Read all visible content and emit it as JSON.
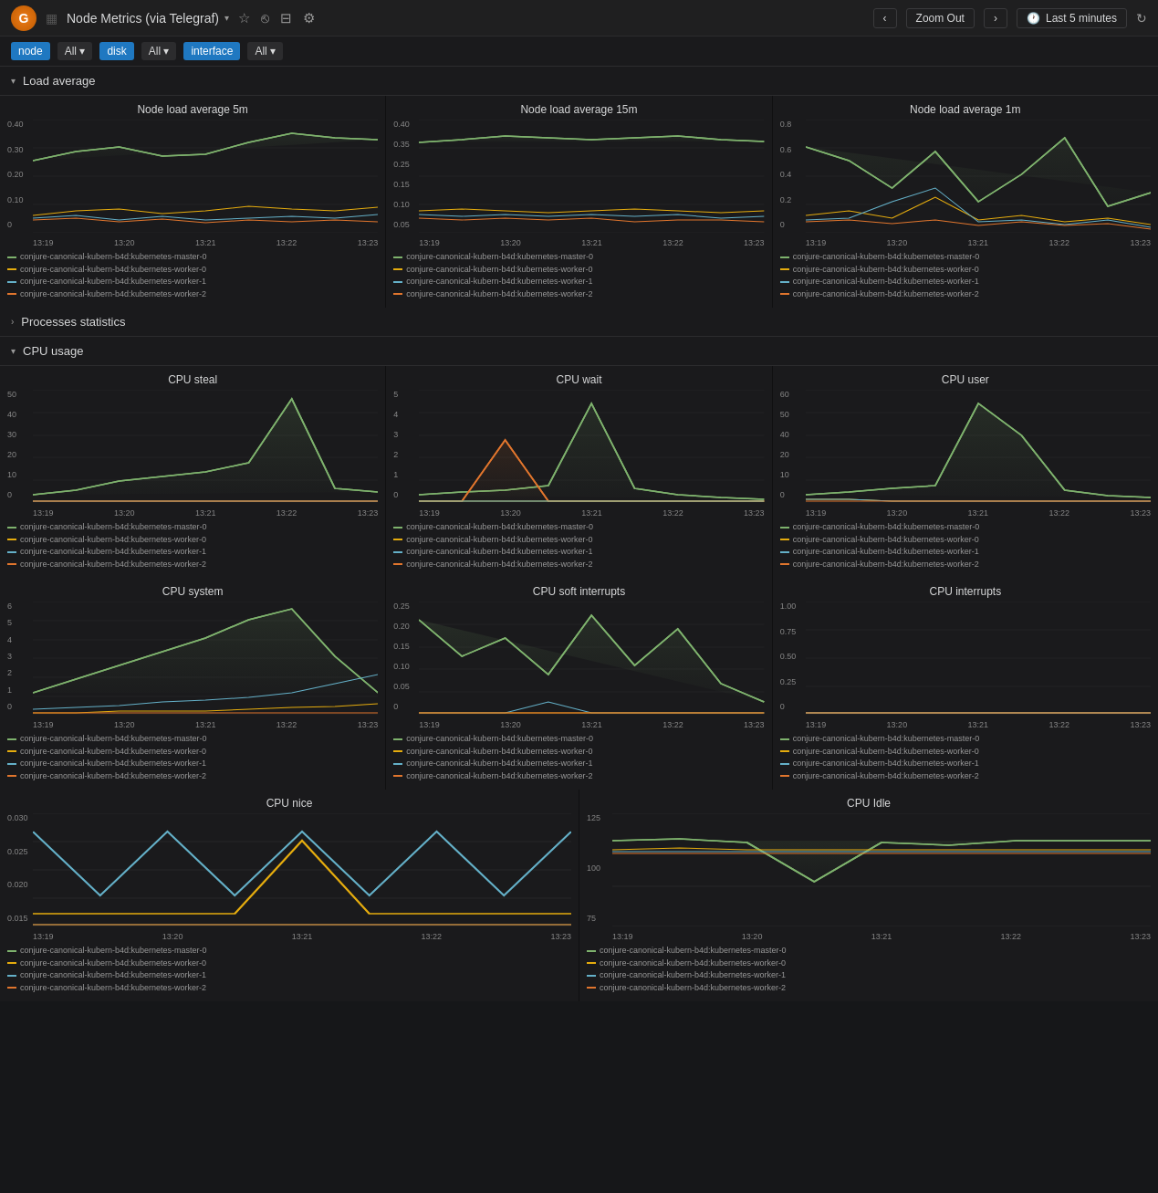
{
  "topbar": {
    "logo_label": "G",
    "dashboard_icon": "▦",
    "dashboard_title": "Node Metrics (via Telegraf)",
    "dropdown_arrow": "▾",
    "star_icon": "☆",
    "share_icon": "⎋",
    "save_icon": "⊟",
    "settings_icon": "⚙",
    "zoom_out_label": "Zoom Out",
    "nav_prev": "‹",
    "nav_next": "›",
    "clock_icon": "🕐",
    "time_range": "Last 5 minutes",
    "refresh_icon": "↻"
  },
  "filterbar": {
    "node_label": "node",
    "node_all_label": "All ▾",
    "disk_label": "disk",
    "disk_all_label": "All ▾",
    "interface_label": "interface",
    "interface_all_label": "All ▾"
  },
  "sections": {
    "load_average_label": "Load average",
    "processes_label": "Processes statistics",
    "cpu_usage_label": "CPU usage"
  },
  "legend": {
    "master0": "conjure-canonical-kubern-b4d:kubernetes-master-0",
    "worker0": "conjure-canonical-kubern-b4d:kubernetes-worker-0",
    "worker1": "conjure-canonical-kubern-b4d:kubernetes-worker-1",
    "worker2": "conjure-canonical-kubern-b4d:kubernetes-worker-2",
    "colors": {
      "master0": "#7eb26d",
      "worker0": "#e5ac0e",
      "worker1": "#64b0c8",
      "worker2": "#e0752d"
    }
  },
  "charts": {
    "load_5m_title": "Node load average 5m",
    "load_15m_title": "Node load average 15m",
    "load_1m_title": "Node load average 1m",
    "cpu_steal_title": "CPU steal",
    "cpu_wait_title": "CPU wait",
    "cpu_user_title": "CPU user",
    "cpu_system_title": "CPU system",
    "cpu_soft_title": "CPU soft interrupts",
    "cpu_interrupts_title": "CPU interrupts",
    "cpu_nice_title": "CPU nice",
    "cpu_idle_title": "CPU Idle",
    "time_labels": [
      "13:19",
      "13:20",
      "13:21",
      "13:22",
      "13:23"
    ]
  }
}
